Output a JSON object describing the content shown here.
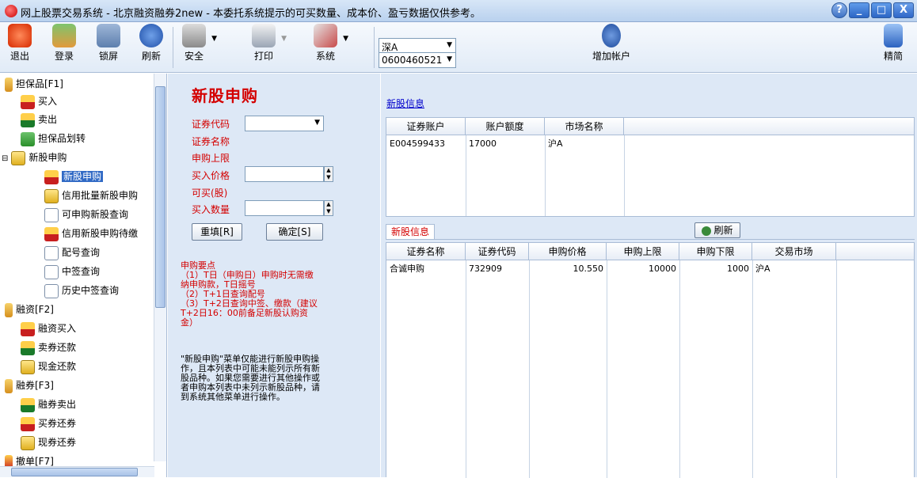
{
  "window": {
    "title": "网上股票交易系统 - 北京融资融券2new - 本委托系统提示的可买数量、成本价、盈亏数据仅供参考。",
    "help": "?",
    "min": "_",
    "max": "□",
    "close": "X"
  },
  "toolbar": {
    "exit": "退出",
    "login": "登录",
    "lock": "锁屏",
    "refresh": "刷新",
    "security": "安全",
    "print": "打印",
    "system": "系统",
    "market": "深A",
    "account": "0600460521",
    "add_account": "增加帐户",
    "simple": "精简"
  },
  "sidebar": {
    "items": [
      {
        "label": "担保品[F1]"
      },
      {
        "label": "买入"
      },
      {
        "label": "卖出"
      },
      {
        "label": "担保品划转"
      },
      {
        "label": "新股申购"
      },
      {
        "label": "新股申购"
      },
      {
        "label": "信用批量新股申购"
      },
      {
        "label": "可申购新股查询"
      },
      {
        "label": "信用新股申购待缴"
      },
      {
        "label": "配号查询"
      },
      {
        "label": "中签查询"
      },
      {
        "label": "历史中签查询"
      },
      {
        "label": "融资[F2]"
      },
      {
        "label": "融资买入"
      },
      {
        "label": "卖券还款"
      },
      {
        "label": "现金还款"
      },
      {
        "label": "融券[F3]"
      },
      {
        "label": "融券卖出"
      },
      {
        "label": "买券还券"
      },
      {
        "label": "现券还券"
      },
      {
        "label": "撤单[F7]"
      }
    ]
  },
  "form": {
    "title": "新股申购",
    "code_label": "证券代码",
    "name_label": "证券名称",
    "limit_label": "申购上限",
    "price_label": "买入价格",
    "avail_label": "可买(股)",
    "qty_label": "买入数量",
    "reset": "重填[R]",
    "confirm": "确定[S]",
    "notes": "申购要点\n（1）T日（申购日）申购时无需缴\n纳申购款，T日摇号\n（2）T+1日查询配号\n（3）T+2日查询中签、缴款（建议\nT+2日16：00前备足新股认购资\n金）",
    "disclaimer": "\"新股申购\"菜单仅能进行新股申购操\n作，且本列表中可能未能列示所有新\n股品种。如果您需要进行其他操作或\n者申购本列表中未列示新股品种，请\n到系统其他菜单进行操作。"
  },
  "quota": {
    "link": "新股信息",
    "headers": [
      "证券账户",
      "账户额度",
      "市场名称"
    ],
    "rows": [
      [
        "E004599433",
        "17000",
        "沪A"
      ]
    ]
  },
  "ipo": {
    "tab": "新股信息",
    "refresh": "刷新",
    "headers": [
      "证券名称",
      "证券代码",
      "申购价格",
      "申购上限",
      "申购下限",
      "交易市场"
    ],
    "rows": [
      [
        "合诚申购",
        "732909",
        "10.550",
        "10000",
        "1000",
        "沪A"
      ]
    ]
  }
}
